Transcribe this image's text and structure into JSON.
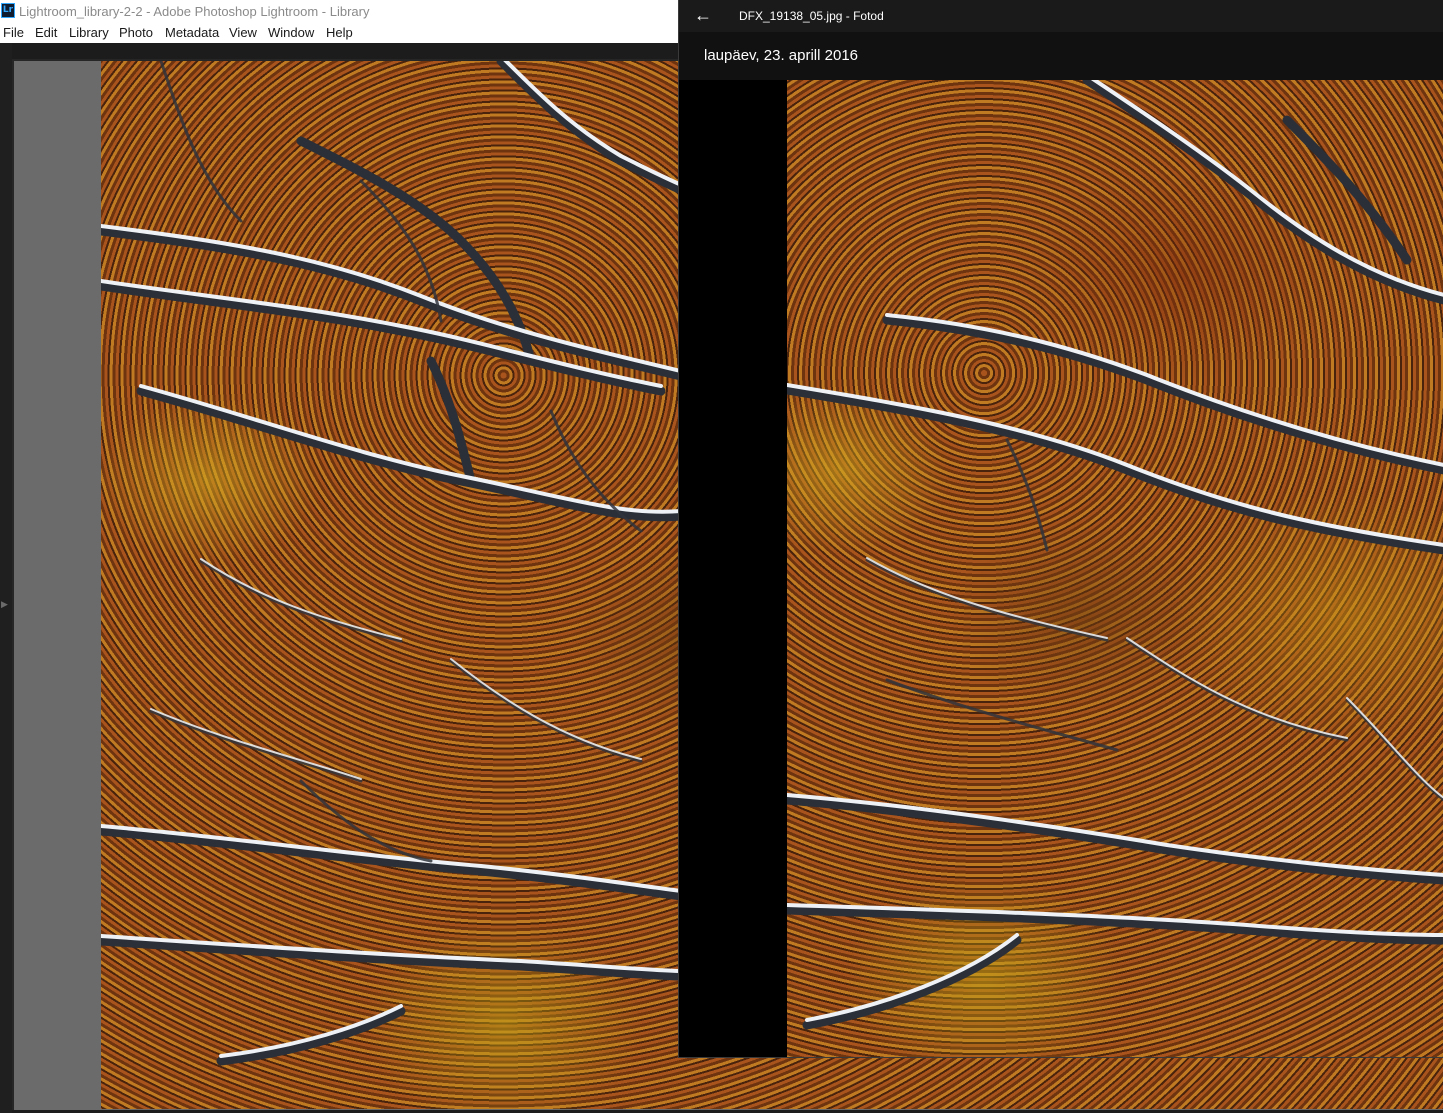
{
  "lightroom": {
    "app_icon": "Lr",
    "title": "Lightroom_library-2-2 - Adobe Photoshop Lightroom - Library",
    "menu": [
      "File",
      "Edit",
      "Library",
      "Photo",
      "Metadata",
      "View",
      "Window",
      "Help"
    ],
    "left_panel_toggle_icon": "triangle-right-icon"
  },
  "photos_app": {
    "back_icon": "←",
    "title": "DFX_19138_05.jpg - Fotod",
    "date": "laupäev, 23. aprill 2016"
  }
}
